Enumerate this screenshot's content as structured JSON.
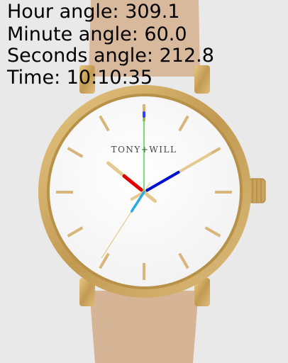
{
  "overlay": {
    "hour_angle": "Hour angle: 309.1",
    "minute_angle": "Minute angle: 60.0",
    "seconds_angle": "Seconds angle: 212.8",
    "time": "Time: 10:10:35"
  },
  "watch": {
    "brand": "TONY+WILL",
    "hour_angle_deg": 309.1,
    "minute_angle_deg": 60.0,
    "seconds_angle_deg": 212.8
  },
  "colors": {
    "background": "#e9e9e9",
    "strap": "#d8b89c",
    "case_gold": "#c9a35a",
    "dial": "#ffffff",
    "hour_indices": "#d8b57a",
    "hour_hand_marker": "#e00000",
    "minute_hand_marker": "#0010d0",
    "seconds_hand_marker": "#2aa8e0",
    "reference_line": "#1fcc1f"
  }
}
